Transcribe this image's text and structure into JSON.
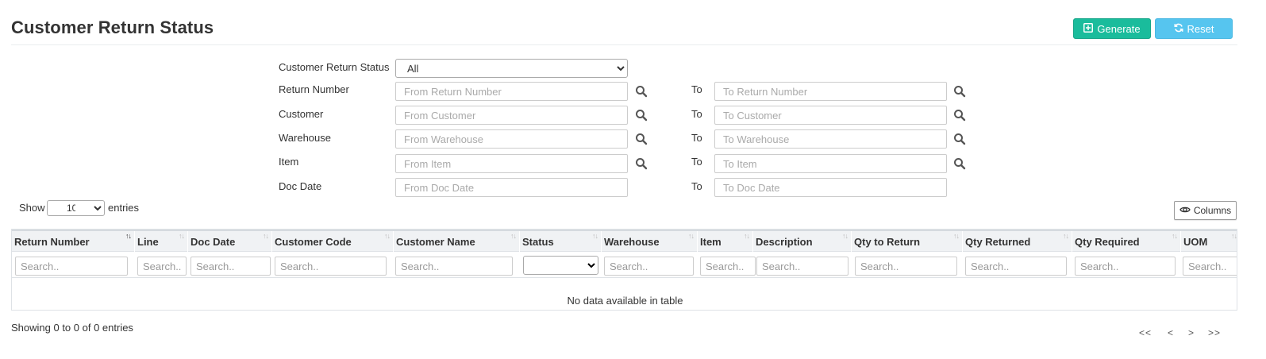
{
  "header": {
    "title": "Customer Return Status",
    "generate_label": "Generate",
    "reset_label": "Reset"
  },
  "filters": {
    "status": {
      "label": "Customer Return Status",
      "selected": "All"
    },
    "to_label": "To",
    "rows": [
      {
        "label": "Return Number",
        "from_placeholder": "From Return Number",
        "to_placeholder": "To Return Number"
      },
      {
        "label": "Customer",
        "from_placeholder": "From Customer",
        "to_placeholder": "To Customer"
      },
      {
        "label": "Warehouse",
        "from_placeholder": "From Warehouse",
        "to_placeholder": "To Warehouse"
      },
      {
        "label": "Item",
        "from_placeholder": "From Item",
        "to_placeholder": "To Item"
      },
      {
        "label": "Doc Date",
        "from_placeholder": "From Doc Date",
        "to_placeholder": "To Doc Date"
      }
    ]
  },
  "table": {
    "show_label": "Show",
    "page_length": "10",
    "entries_label": "entries",
    "columns_button": "Columns",
    "search_placeholder": "Search..",
    "columns": [
      "Return Number",
      "Line",
      "Doc Date",
      "Customer Code",
      "Customer Name",
      "Status",
      "Warehouse",
      "Item",
      "Description",
      "Qty to Return",
      "Qty Returned",
      "Qty Required",
      "UOM"
    ],
    "empty_message": "No data available in table",
    "info": "Showing 0 to 0 of 0 entries",
    "pager": {
      "first": "<<",
      "prev": "<",
      "next": ">",
      "last": ">>"
    }
  },
  "colors": {
    "generate": "#1abc9c",
    "reset": "#56c5ef"
  },
  "icons": {
    "generate": "plus-square-icon",
    "reset": "refresh-icon",
    "lookup": "search-icon",
    "columns": "eye-icon"
  }
}
